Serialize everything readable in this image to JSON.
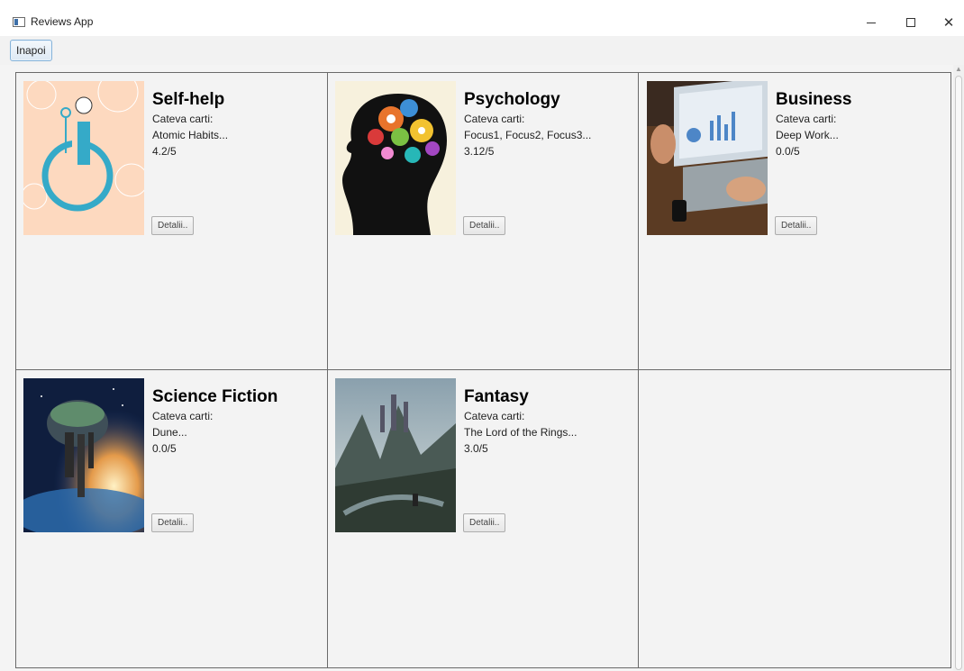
{
  "window": {
    "title": "Reviews App",
    "minimize_icon": "minimize-icon",
    "maximize_icon": "maximize-icon",
    "close_icon": "close-icon",
    "close_glyph": "✕"
  },
  "toolbar": {
    "back_label": "Inapoi"
  },
  "categories": [
    {
      "name": "Self-help",
      "books_label": "Cateva carti:",
      "books": "Atomic Habits...",
      "rating": "4.2/5",
      "details_label": "Detalii.."
    },
    {
      "name": "Psychology",
      "books_label": "Cateva carti:",
      "books": "Focus1, Focus2, Focus3...",
      "rating": "3.12/5",
      "details_label": "Detalii.."
    },
    {
      "name": "Business",
      "books_label": "Cateva carti:",
      "books": "Deep Work...",
      "rating": "0.0/5",
      "details_label": "Detalii.."
    },
    {
      "name": "Science Fiction",
      "books_label": "Cateva carti:",
      "books": "Dune...",
      "rating": "0.0/5",
      "details_label": "Detalii.."
    },
    {
      "name": "Fantasy",
      "books_label": "Cateva carti:",
      "books": "The Lord of the Rings...",
      "rating": "3.0/5",
      "details_label": "Detalii.."
    }
  ],
  "colors": {
    "selfhelp_bg": "#fdd9bf",
    "selfhelp_line": "#35aac8",
    "psychology_head": "#111111",
    "business_wood": "#5b3b23",
    "scifi_sky": "#1d3b70",
    "fantasy_sky": "#8aa0ad"
  }
}
